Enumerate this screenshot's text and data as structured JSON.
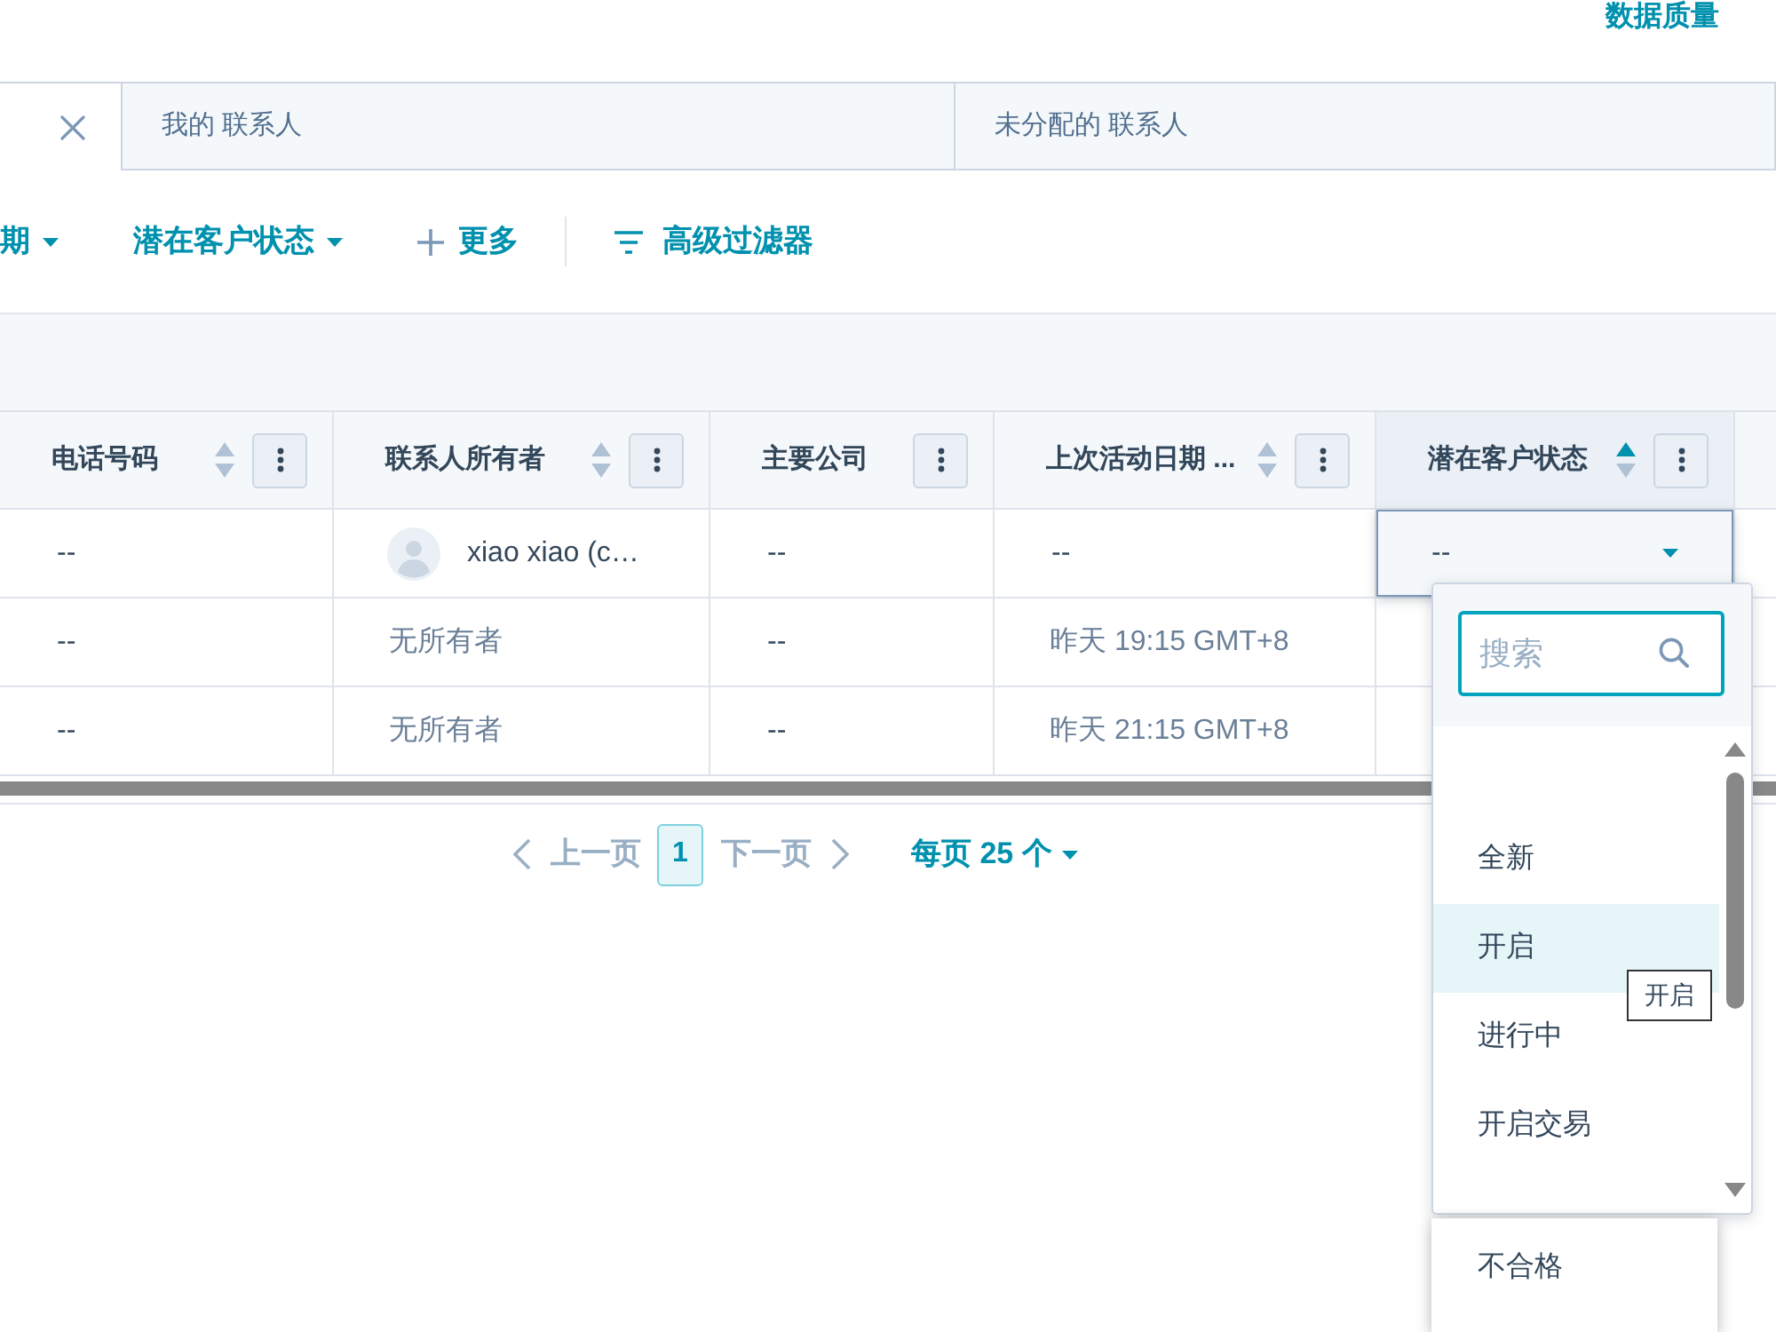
{
  "top_link": "数据质量",
  "tabs": [
    {
      "selected": true,
      "closable": true
    },
    {
      "label": "我的 联系人",
      "selected": false
    },
    {
      "label": "未分配的 联系人",
      "selected": false
    }
  ],
  "filters": [
    {
      "kind": "dropdown",
      "label": "期"
    },
    {
      "kind": "dropdown",
      "label": "潜在客户状态"
    },
    {
      "kind": "add",
      "label": "更多"
    },
    {
      "kind": "advanced",
      "label": "高级过滤器"
    }
  ],
  "table": {
    "columns": [
      {
        "label": "电话号码",
        "sortable": true,
        "sorted": false
      },
      {
        "label": "联系人所有者",
        "sortable": true,
        "sorted": false
      },
      {
        "label": "主要公司"
      },
      {
        "label": "上次活动日期 ...",
        "sortable": true,
        "sorted": false
      },
      {
        "label": "潜在客户状态",
        "sortable": true,
        "sorted": true
      }
    ],
    "rows": [
      {
        "cells": [
          {
            "kind": "text",
            "text": "--"
          },
          {
            "kind": "owner",
            "text": "xiao xiao (c…"
          },
          {
            "kind": "text",
            "text": "--"
          },
          {
            "kind": "text",
            "text": "--"
          },
          {
            "kind": "select",
            "text": "--"
          }
        ]
      },
      {
        "cells": [
          {
            "kind": "text",
            "text": "--"
          },
          {
            "kind": "muted",
            "text": "无所有者"
          },
          {
            "kind": "text",
            "text": "--"
          },
          {
            "kind": "muted",
            "text": "昨天 19:15 GMT+8"
          },
          null
        ]
      },
      {
        "cells": [
          {
            "kind": "text",
            "text": "--"
          },
          {
            "kind": "muted",
            "text": "无所有者"
          },
          {
            "kind": "text",
            "text": "--"
          },
          {
            "kind": "muted",
            "text": "昨天 21:15 GMT+8"
          },
          null
        ]
      }
    ]
  },
  "pagination": {
    "previous": {
      "label": "上一页",
      "disabled": true
    },
    "pages": [
      {
        "label": "1",
        "selected": true
      }
    ],
    "next": {
      "label": "下一页",
      "disabled": true
    },
    "page_size": "每页 25 个"
  },
  "status_dropdown": {
    "search": {
      "placeholder": "搜索"
    },
    "options": [
      {
        "label": "全新",
        "highlighted": false
      },
      {
        "label": "开启",
        "highlighted": true
      },
      {
        "label": "进行中",
        "highlighted": false
      },
      {
        "label": "开启交易",
        "highlighted": false
      }
    ],
    "tooltip": "开启"
  },
  "floating_option": "不合格"
}
